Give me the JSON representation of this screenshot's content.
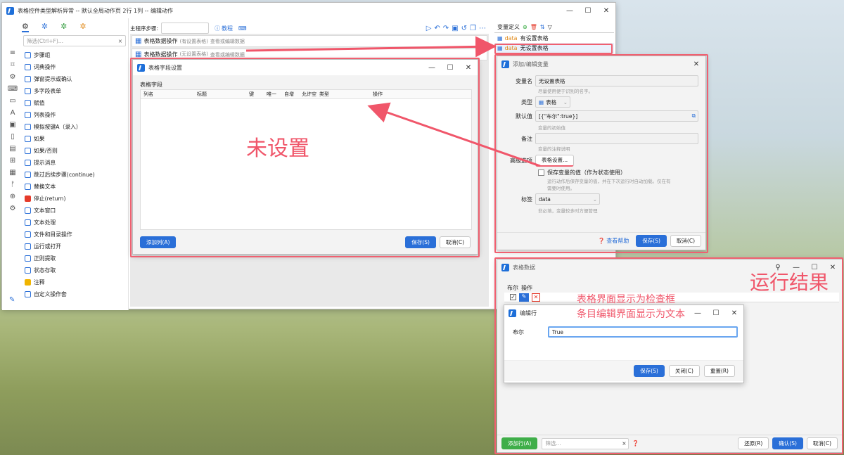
{
  "main_window": {
    "title": "表格控件类型解析异常 -- 默认全局动作页 2行 1列 -- 编辑动作",
    "search_placeholder": "筛选(Ctrl+F)...",
    "main_steps_label": "主程序步骤:",
    "tutorial": "教程",
    "rows": [
      {
        "name": "表格数据操作",
        "tag": "(有设置表格)",
        "desc": "查看或编辑数据"
      },
      {
        "name": "表格数据操作",
        "tag": "(无设置表格)",
        "desc": "查看或编辑数据"
      }
    ],
    "tree": [
      "步骤组",
      "词典操作",
      "弹窗提示或确认",
      "多字段表单",
      "赋值",
      "列表操作",
      "模拟按键A（录入）",
      "如果",
      "如果/否则",
      "提示消息",
      "跳过后续步骤(continue)",
      "替换文本",
      "停止(return)",
      "文本窗口",
      "文本处理",
      "文件和目录操作",
      "运行或打开",
      "正则提取",
      "状态存取",
      "注释",
      "自定义操作套"
    ],
    "var_header": "变量定义",
    "vars": [
      {
        "type": "data",
        "name": "有设置表格"
      },
      {
        "type": "data",
        "name": "无设置表格"
      }
    ]
  },
  "field_dialog": {
    "title": "表格字段设置",
    "section": "表格字段",
    "columns": [
      "列名",
      "标题",
      "键",
      "唯一",
      "自增",
      "允许空",
      "类型",
      "操作"
    ],
    "add_col": "添加列(A)",
    "save": "保存(S)",
    "cancel": "取消(C)"
  },
  "var_dialog": {
    "title": "添加/编辑变量",
    "name_label": "变量名",
    "name_value": "无设置表格",
    "name_hint": "尽量使用便于识别的名字。",
    "type_label": "类型",
    "type_value": "表格",
    "default_label": "默认值",
    "default_value": "[{\"布尔\":true}]",
    "default_hint": "变量的初始值",
    "note_label": "备注",
    "note_hint": "变量的注释说明",
    "adv_label": "高级选项",
    "adv_btn": "表格设置...",
    "save_state": "保存变量的值（作为状态使用）",
    "save_state_hint": "运行动作后保存变量的值，并在下次运行时自动加载。仅在有需要时使用。",
    "tag_label": "标签",
    "tag_value": "data",
    "tag_hint": "非必填，变量较多时方便管理",
    "help": "查看帮助",
    "save": "保存(S)",
    "cancel": "取消(C)"
  },
  "table_data": {
    "title": "表格数据",
    "col1": "布尔",
    "col2": "操作",
    "add_row": "添加行(A)",
    "filter_placeholder": "筛选...",
    "restore": "还原(R)",
    "ok": "确认(S)",
    "cancel": "取消(C)"
  },
  "edit_row": {
    "title": "编辑行",
    "label": "布尔",
    "value": "True",
    "save": "保存(S)",
    "close": "关闭(C)",
    "reset": "重置(R)"
  },
  "annotations": {
    "unset": "未设置",
    "result": "运行结果",
    "note1": "表格界面显示为检查框",
    "note2": "条目编辑界面显示为文本"
  },
  "colors": {
    "accent": "#2a6fd8",
    "callout": "#f0566a",
    "green": "#3fae49"
  }
}
